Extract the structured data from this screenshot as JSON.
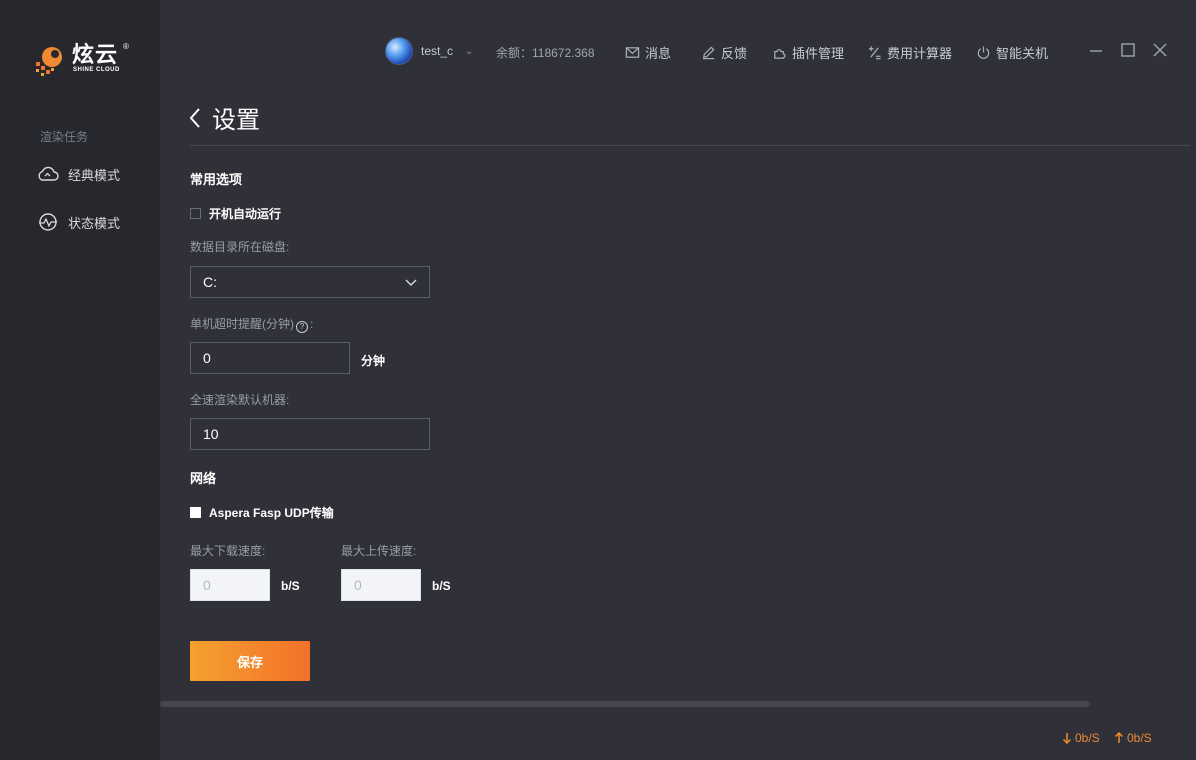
{
  "brand": {
    "name": "炫云",
    "sub": "SHINE CLOUD",
    "reg": "®",
    "colors": {
      "orange": "#f4712b",
      "white": "#ffffff"
    }
  },
  "sidebar": {
    "section_label": "渲染任务",
    "items": [
      {
        "label": "经典模式",
        "icon": "cloud-icon"
      },
      {
        "label": "状态模式",
        "icon": "status-gauge-icon"
      }
    ]
  },
  "topbar": {
    "user": {
      "name": "test_c",
      "chevron": "⌄"
    },
    "balance": "余额：118672.368",
    "links": [
      {
        "label": "消息",
        "icon": "mail-icon"
      },
      {
        "label": "反馈",
        "icon": "pencil-icon"
      },
      {
        "label": "插件管理",
        "icon": "plugin-icon"
      },
      {
        "label": "费用计算器",
        "icon": "calculator-icon"
      },
      {
        "label": "智能关机",
        "icon": "power-icon"
      }
    ]
  },
  "page": {
    "title": "设置"
  },
  "common": {
    "title": "常用选项",
    "autostart_label": "开机自动运行",
    "disk_label": "数据目录所在磁盘:",
    "disk_value": "C:",
    "timeout_label_prefix": "单机超时提醒(分钟)",
    "timeout_help": "?",
    "timeout_label_suffix": ":",
    "timeout_value": "0",
    "timeout_unit": "分钟",
    "default_machines_label": "全速渲染默认机器:",
    "default_machines_value": "10"
  },
  "network": {
    "title": "网络",
    "aspera_label": "Aspera Fasp UDP传输",
    "max_download_label": "最大下载速度:",
    "max_download_value": "0",
    "max_download_unit": "b/S",
    "max_upload_label": "最大上传速度:",
    "max_upload_value": "0",
    "max_upload_unit": "b/S"
  },
  "actions": {
    "save_label": "保存"
  },
  "status": {
    "download": "0b/S",
    "upload": "0b/S"
  }
}
